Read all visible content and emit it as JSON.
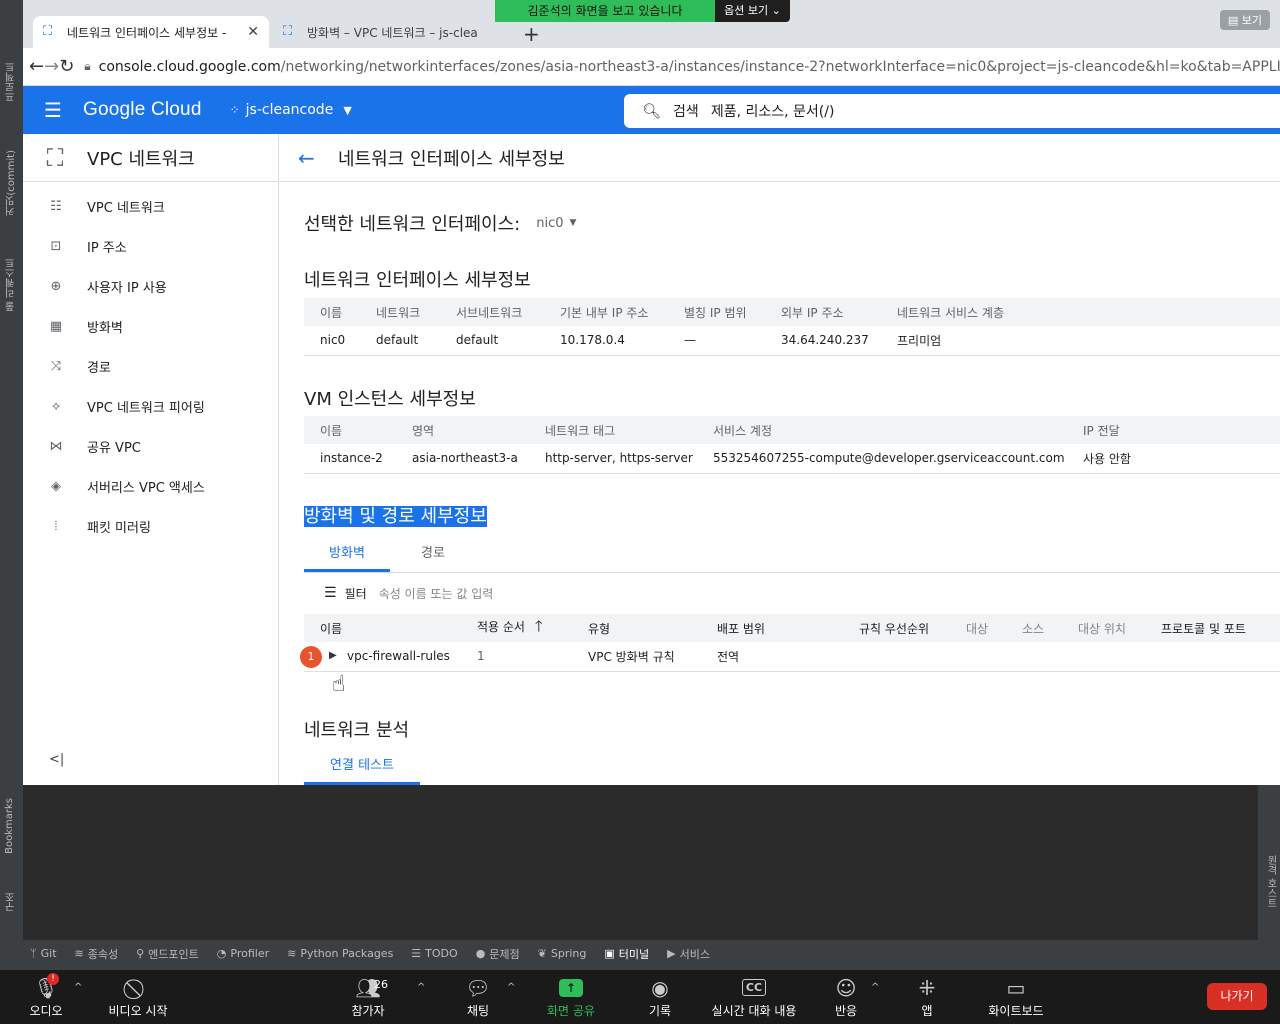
{
  "ide": {
    "left_labels": [
      "프로젝트",
      "커밋(commit)",
      "풀 리퀘스트",
      "Bookmarks",
      "구조"
    ],
    "right_label": "원격 호스트",
    "tools": [
      {
        "icon": "branch-icon",
        "glyph": "ᛘ",
        "label": "Git"
      },
      {
        "icon": "layers-icon",
        "glyph": "≋",
        "label": "종속성"
      },
      {
        "icon": "endpoints-icon",
        "glyph": "⚲",
        "label": "엔드포인트"
      },
      {
        "icon": "profiler-icon",
        "glyph": "◔",
        "label": "Profiler"
      },
      {
        "icon": "packages-icon",
        "glyph": "≋",
        "label": "Python Packages"
      },
      {
        "icon": "todo-icon",
        "glyph": "☰",
        "label": "TODO"
      },
      {
        "icon": "problems-icon",
        "glyph": "●",
        "label": "문제점"
      },
      {
        "icon": "spring-icon",
        "glyph": "❦",
        "label": "Spring"
      },
      {
        "icon": "terminal-icon",
        "glyph": "▣",
        "label": "터미널"
      },
      {
        "icon": "services-icon",
        "glyph": "▶",
        "label": "서비스"
      }
    ]
  },
  "browser": {
    "tabs": [
      {
        "title": "네트워크 인터페이스 세부정보 -",
        "active": true
      },
      {
        "title": "방화벽 – VPC 네트워크 – js-clea",
        "active": false
      }
    ],
    "share_banner": "김준석의 화면을 보고 있습니다",
    "share_options": "옵션 보기",
    "view_button": "보기",
    "url_host": "console.cloud.google.com",
    "url_path": "/networking/networkinterfaces/zones/asia-northeast3-a/instances/instance-2?networkInterface=nic0&project=js-cleancode&hl=ko&tab=APPLICABLE_"
  },
  "gcp": {
    "logo": "Google Cloud",
    "project": "js-cleancode",
    "search_label": "검색",
    "search_placeholder": "제품, 리소스, 문서(/)"
  },
  "sidebar": {
    "title": "VPC 네트워크",
    "items": [
      {
        "icon": "vpc-network-icon",
        "glyph": "☷",
        "label": "VPC 네트워크"
      },
      {
        "icon": "ip-address-icon",
        "glyph": "⊡",
        "label": "IP 주소"
      },
      {
        "icon": "globe-icon",
        "glyph": "⊕",
        "label": "사용자 IP 사용"
      },
      {
        "icon": "firewall-icon",
        "glyph": "▦",
        "label": "방화벽"
      },
      {
        "icon": "route-icon",
        "glyph": "⤨",
        "label": "경로"
      },
      {
        "icon": "peering-icon",
        "glyph": "⟡",
        "label": "VPC 네트워크 피어링"
      },
      {
        "icon": "shared-vpc-icon",
        "glyph": "⋈",
        "label": "공유 VPC"
      },
      {
        "icon": "serverless-icon",
        "glyph": "◈",
        "label": "서버리스 VPC 액세스"
      },
      {
        "icon": "packet-mirroring-icon",
        "glyph": "⦙",
        "label": "패킷 미러링"
      }
    ],
    "collapse_label": "<|"
  },
  "main": {
    "title": "네트워크 인터페이스 세부정보",
    "selected_label": "선택한 네트워크 인터페이스:",
    "selected_value": "nic0",
    "nic_section": {
      "title": "네트워크 인터페이스 세부정보",
      "headers": [
        "이름",
        "네트워크",
        "서브네트워크",
        "기본 내부 IP 주소",
        "별칭 IP 범위",
        "외부 IP 주소",
        "네트워크 서비스 계층"
      ],
      "row": [
        "nic0",
        "default",
        "default",
        "10.178.0.4",
        "—",
        "34.64.240.237",
        "프리미엄"
      ]
    },
    "vm_section": {
      "title": "VM 인스턴스 세부정보",
      "headers": [
        "이름",
        "영역",
        "네트워크 태그",
        "서비스 계정",
        "IP 전달"
      ],
      "row": [
        "instance-2",
        "asia-northeast3-a",
        "http-server, https-server",
        "553254607255-compute@developer.gserviceaccount.com",
        "사용 안함"
      ]
    },
    "fw_section": {
      "title": "방화벽 및 경로 세부정보",
      "tabs": [
        "방화벽",
        "경로"
      ],
      "filter_label": "필터",
      "filter_placeholder": "속성 이름 또는 값 입력",
      "headers": [
        "이름",
        "적용 순서",
        "유형",
        "배포 범위",
        "규칙 우선순위",
        "대상",
        "소스",
        "대상 위치",
        "프로토콜 및 포트"
      ],
      "row": {
        "badge": "1",
        "name": "vpc-firewall-rules",
        "order": "1",
        "type": "VPC 방화벽 규칙",
        "scope": "전역"
      }
    },
    "analysis_section": {
      "title": "네트워크 분석",
      "tab": "연결 테스트"
    }
  },
  "zoom": {
    "audio": "오디오",
    "audio_badge": "!",
    "video": "비디오 시작",
    "participants": "참가자",
    "participants_count": "26",
    "chat": "채팅",
    "share": "화면 공유",
    "record": "기록",
    "captions": "실시간 대화 내용",
    "captions_icon_text": "CC",
    "reactions": "반응",
    "apps": "앱",
    "whiteboard": "화이트보드",
    "leave": "나가기"
  }
}
